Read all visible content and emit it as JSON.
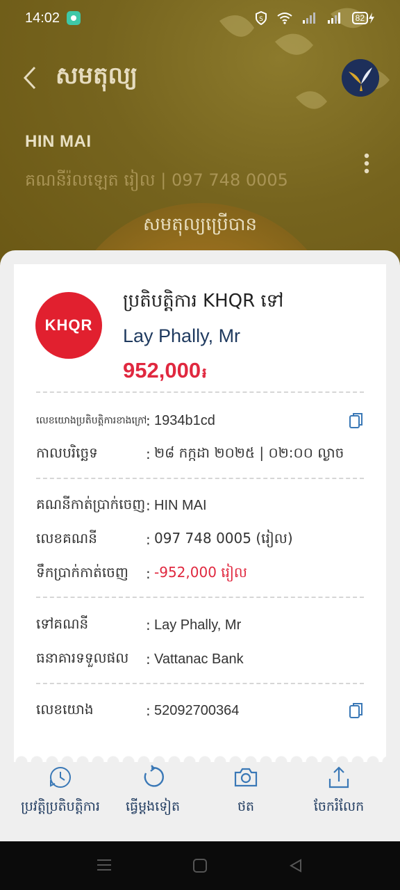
{
  "status_bar": {
    "time": "14:02",
    "battery": "82"
  },
  "header": {
    "title": "សមតុល្យ",
    "account_name": "HIN MAI",
    "account_sub": "គណនីរ៉លឡេត រៀល | 097 748 0005",
    "balance_label": "សមតុល្យប្រើបាន"
  },
  "receipt": {
    "logo_text": "KHQR",
    "tx_type": "ប្រតិបត្តិការ KHQR ទៅ",
    "payee": "Lay Phally, Mr",
    "amount": "952,000",
    "currency_symbol": "៛",
    "groups": [
      [
        {
          "label": "លេខយោងប្រតិបត្តិការខាងក្រៅ",
          "value": "1934b1cd",
          "copy": true
        },
        {
          "label": "កាលបរិច្ឆេទ",
          "value": "២៨ កក្កដា ២០២៥ | ០២:០០ ល្ងាច"
        }
      ],
      [
        {
          "label": "គណនីកាត់ប្រាក់ចេញ",
          "value": "HIN MAI"
        },
        {
          "label": "លេខគណនី",
          "value": "097 748 0005 (រៀល)"
        },
        {
          "label": "ទឹកប្រាក់កាត់ចេញ",
          "value": "-952,000 រៀល",
          "red": true
        }
      ],
      [
        {
          "label": "ទៅគណនី",
          "value": "Lay Phally, Mr"
        },
        {
          "label": "ធនាគារទទួលផល",
          "value": "Vattanac Bank"
        }
      ],
      [
        {
          "label": "លេខយោង",
          "value": "52092700364",
          "copy": true
        }
      ]
    ]
  },
  "actions": [
    {
      "label": "ប្រវត្តិប្រតិបត្តិការ",
      "icon": "history-icon"
    },
    {
      "label": "ធ្វើម្តងទៀត",
      "icon": "repeat-icon"
    },
    {
      "label": "ថត",
      "icon": "camera-icon"
    },
    {
      "label": "ចែករំលែក",
      "icon": "share-icon"
    }
  ],
  "colors": {
    "accent_red": "#e0283f",
    "navy": "#1f3a5f",
    "action_blue": "#3a78b6",
    "header_gold": "#76641e"
  }
}
